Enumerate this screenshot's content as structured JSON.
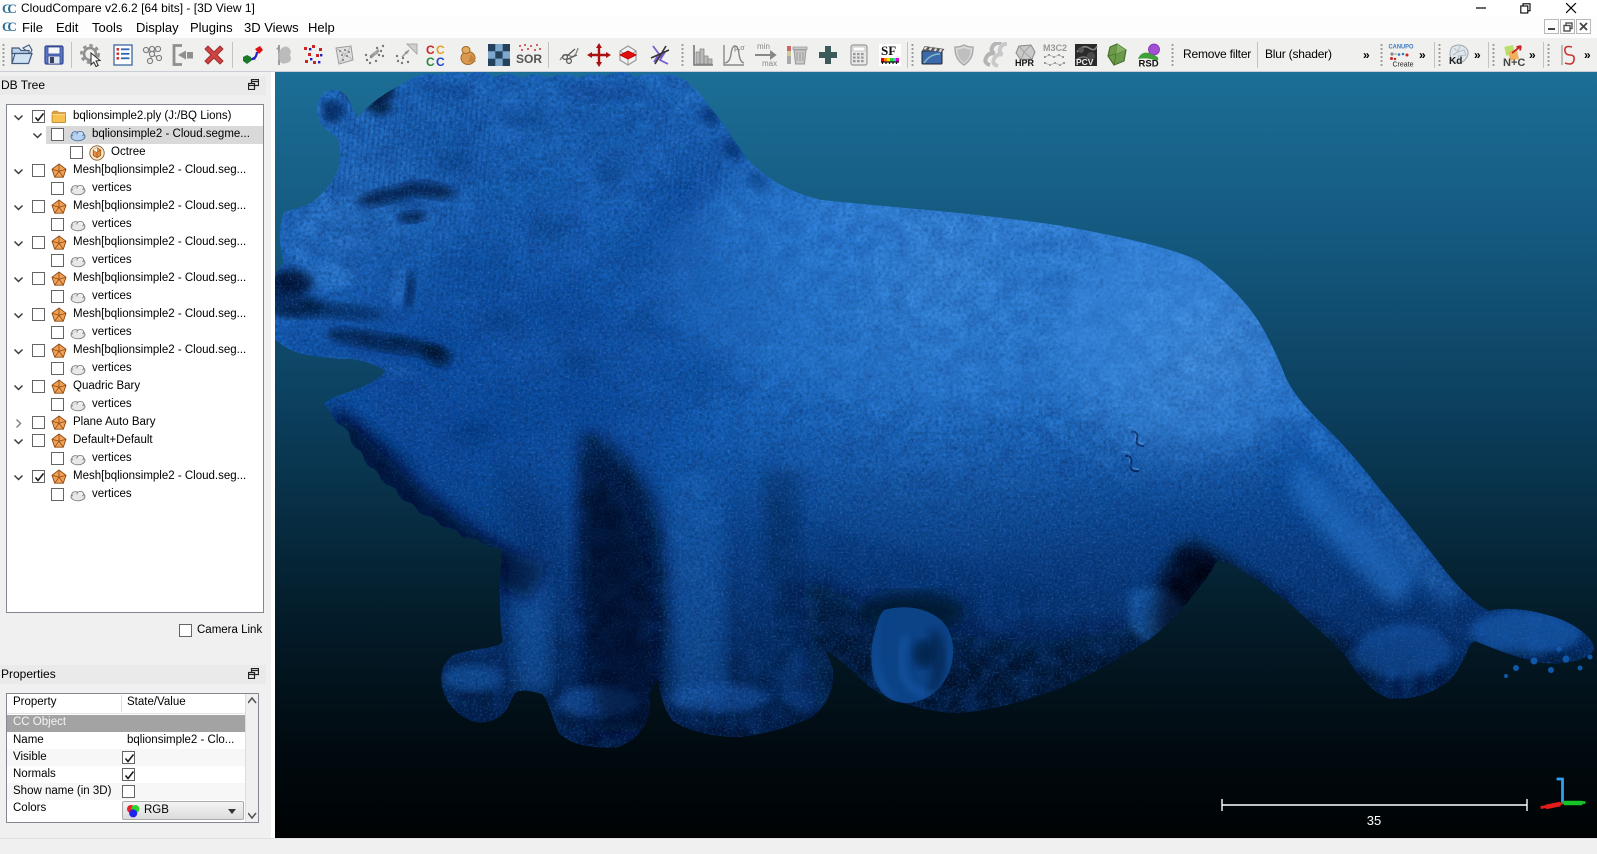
{
  "window": {
    "title": "CloudCompare v2.6.2 [64 bits] - [3D View 1]",
    "buttons": [
      "minimize",
      "restore",
      "close"
    ]
  },
  "menu": {
    "items": [
      "File",
      "Edit",
      "Tools",
      "Display",
      "Plugins",
      "3D Views",
      "Help"
    ]
  },
  "toolbar": {
    "remove_filter_label": "Remove filter",
    "blur_shader_label": "Blur (shader)",
    "overflow_chevron": "»",
    "icons": [
      "open",
      "save",
      "pick-rotation-center",
      "toggle-console",
      "point-picking",
      "apply-transformation",
      "delete",
      "clone",
      "raise-flag",
      "subsample",
      "mesh-sampling",
      "fine-registration",
      "align",
      "cloud-cloud-distance",
      "density",
      "chunk",
      "sor-filter",
      "cross-section",
      "translate-rotate",
      "clipping-box",
      "segment",
      "histogram",
      "gaussian-filter",
      "minmax-scale",
      "delete-scalar-field",
      "add-constant-sf",
      "sf-arithmetic",
      "show-scalar-field",
      "animation",
      "shield",
      "smooth-ss",
      "hpr",
      "m3c2",
      "pcv",
      "poisson-recon",
      "rsd",
      "canupo-create",
      "kd-tree",
      "normals-compute",
      "s-curve"
    ]
  },
  "db_tree": {
    "title": "DB Tree",
    "camera_link_label": "Camera Link",
    "rows": [
      {
        "label": "bqlionsimple2.ply (J:/BQ Lions)",
        "icon": "folder",
        "level": 0,
        "expander": "open",
        "checked": true,
        "selected": false
      },
      {
        "label": "bqlionsimple2 - Cloud.segme...",
        "icon": "cloud-blue",
        "level": 1,
        "expander": "open",
        "checked": false,
        "selected": true
      },
      {
        "label": "Octree",
        "icon": "octree",
        "level": 2,
        "expander": "none",
        "checked": false,
        "selected": false
      },
      {
        "label": "Mesh[bqlionsimple2 - Cloud.seg...",
        "icon": "mesh",
        "level": 0,
        "expander": "open",
        "checked": false,
        "selected": false
      },
      {
        "label": "vertices",
        "icon": "cloud",
        "level": 1,
        "expander": "none",
        "checked": false,
        "selected": false
      },
      {
        "label": "Mesh[bqlionsimple2 - Cloud.seg...",
        "icon": "mesh",
        "level": 0,
        "expander": "open",
        "checked": false,
        "selected": false
      },
      {
        "label": "vertices",
        "icon": "cloud",
        "level": 1,
        "expander": "none",
        "checked": false,
        "selected": false
      },
      {
        "label": "Mesh[bqlionsimple2 - Cloud.seg...",
        "icon": "mesh",
        "level": 0,
        "expander": "open",
        "checked": false,
        "selected": false
      },
      {
        "label": "vertices",
        "icon": "cloud",
        "level": 1,
        "expander": "none",
        "checked": false,
        "selected": false
      },
      {
        "label": "Mesh[bqlionsimple2 - Cloud.seg...",
        "icon": "mesh",
        "level": 0,
        "expander": "open",
        "checked": false,
        "selected": false
      },
      {
        "label": "vertices",
        "icon": "cloud",
        "level": 1,
        "expander": "none",
        "checked": false,
        "selected": false
      },
      {
        "label": "Mesh[bqlionsimple2 - Cloud.seg...",
        "icon": "mesh",
        "level": 0,
        "expander": "open",
        "checked": false,
        "selected": false
      },
      {
        "label": "vertices",
        "icon": "cloud",
        "level": 1,
        "expander": "none",
        "checked": false,
        "selected": false
      },
      {
        "label": "Mesh[bqlionsimple2 - Cloud.seg...",
        "icon": "mesh",
        "level": 0,
        "expander": "open",
        "checked": false,
        "selected": false
      },
      {
        "label": "vertices",
        "icon": "cloud",
        "level": 1,
        "expander": "none",
        "checked": false,
        "selected": false
      },
      {
        "label": "Quadric Bary",
        "icon": "mesh",
        "level": 0,
        "expander": "open",
        "checked": false,
        "selected": false
      },
      {
        "label": "vertices",
        "icon": "cloud",
        "level": 1,
        "expander": "none",
        "checked": false,
        "selected": false
      },
      {
        "label": "Plane Auto Bary",
        "icon": "mesh",
        "level": 0,
        "expander": "closed",
        "checked": false,
        "selected": false
      },
      {
        "label": "Default+Default",
        "icon": "mesh",
        "level": 0,
        "expander": "open",
        "checked": false,
        "selected": false
      },
      {
        "label": "vertices",
        "icon": "cloud",
        "level": 1,
        "expander": "none",
        "checked": false,
        "selected": false
      },
      {
        "label": "Mesh[bqlionsimple2 - Cloud.seg...",
        "icon": "mesh",
        "level": 0,
        "expander": "open",
        "checked": true,
        "selected": false
      },
      {
        "label": "vertices",
        "icon": "cloud",
        "level": 1,
        "expander": "none",
        "checked": false,
        "selected": false
      }
    ]
  },
  "properties": {
    "title": "Properties",
    "columns": [
      "Property",
      "State/Value"
    ],
    "section": "CC Object",
    "rows": [
      {
        "name": "Name",
        "type": "text",
        "value": "bqlionsimple2 - Clo..."
      },
      {
        "name": "Visible",
        "type": "checkbox",
        "value": true
      },
      {
        "name": "Normals",
        "type": "checkbox",
        "value": true
      },
      {
        "name": "Show name (in 3D)",
        "type": "checkbox",
        "value": false
      },
      {
        "name": "Colors",
        "type": "dropdown",
        "value": "RGB"
      }
    ]
  },
  "viewport": {
    "scale_bar_label": "35",
    "background_top": "#1c6e96",
    "background_bottom": "#000304",
    "mesh_color": "#1c70d2",
    "scale_bar_color": "#ffffff",
    "axis_x_color": "#e41c1c",
    "axis_y_color": "#16c426",
    "axis_z_color": "#2da0f2"
  }
}
